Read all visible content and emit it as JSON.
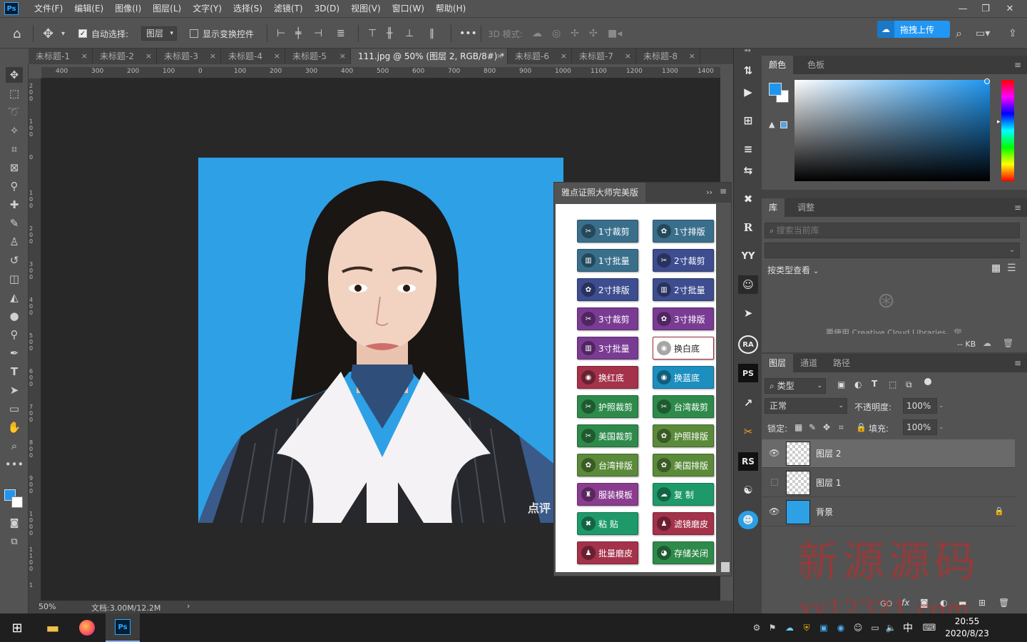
{
  "app": {
    "logo_text": "Ps"
  },
  "menu": [
    "文件(F)",
    "编辑(E)",
    "图像(I)",
    "图层(L)",
    "文字(Y)",
    "选择(S)",
    "滤镜(T)",
    "3D(D)",
    "视图(V)",
    "窗口(W)",
    "帮助(H)"
  ],
  "window_controls": {
    "minimize": "—",
    "restore": "❐",
    "close": "✕"
  },
  "options": {
    "auto_select_label": "自动选择:",
    "auto_select_value": "图层",
    "show_transform_label": "显示变换控件",
    "mode_3d_label": "3D 模式:",
    "more": "•••",
    "upload_label": "拖拽上传"
  },
  "doc_tabs": [
    {
      "label": "未标题-1",
      "close": "×"
    },
    {
      "label": "未标题-2",
      "close": "×"
    },
    {
      "label": "未标题-3",
      "close": "×"
    },
    {
      "label": "未标题-4",
      "close": "×"
    },
    {
      "label": "未标题-5",
      "close": "×"
    },
    {
      "label": "111.jpg @ 50% (图层 2, RGB/8#) *",
      "close": "×"
    },
    {
      "label": "未标题-6",
      "close": "×"
    },
    {
      "label": "未标题-7",
      "close": "×"
    },
    {
      "label": "未标题-8",
      "close": "×"
    }
  ],
  "ruler_h": [
    "400",
    "300",
    "200",
    "100",
    "0",
    "100",
    "200",
    "300",
    "400",
    "500",
    "600",
    "700",
    "800",
    "900",
    "1000",
    "1100",
    "1200",
    "1300",
    "1400"
  ],
  "ruler_v": [
    "2 0 0",
    "1 0 0",
    "0",
    "1 0 0",
    "2 0 0",
    "3 0 0",
    "4 0 0",
    "5 0 0",
    "6 0 0",
    "7 0 0",
    "8 0 0",
    "9 0 0",
    "1 0 0 0",
    "1 1 0 0",
    "1"
  ],
  "status": {
    "zoom": "50%",
    "doc": "文档:3.00M/12.2M",
    "arrow": "›"
  },
  "plugin": {
    "title": "雅点证照大师完美版",
    "collapse": "››",
    "buttons": [
      {
        "label": "1寸裁剪",
        "color": "#3a6f8c",
        "icon": "✂"
      },
      {
        "label": "1寸排版",
        "color": "#3a6f8c",
        "icon": "✿"
      },
      {
        "label": "1寸批量",
        "color": "#3a6f8c",
        "icon": "▥"
      },
      {
        "label": "2寸裁剪",
        "color": "#3d4d8f",
        "icon": "✂"
      },
      {
        "label": "2寸排版",
        "color": "#3d4d8f",
        "icon": "✿"
      },
      {
        "label": "2寸批量",
        "color": "#3d4d8f",
        "icon": "▥"
      },
      {
        "label": "3寸裁剪",
        "color": "#7a3b93",
        "icon": "✂"
      },
      {
        "label": "3寸排版",
        "color": "#7a3b93",
        "icon": "✿"
      },
      {
        "label": "3寸批量",
        "color": "#7a3b93",
        "icon": "▥"
      },
      {
        "label": "换白底",
        "color": "#ffffff",
        "icon": "◉",
        "text_color": "#222",
        "border": "#9a2a3c"
      },
      {
        "label": "换红底",
        "color": "#a3324a",
        "icon": "◉"
      },
      {
        "label": "换蓝底",
        "color": "#1d8fbf",
        "icon": "◉"
      },
      {
        "label": "护照裁剪",
        "color": "#2e8a4a",
        "icon": "✂"
      },
      {
        "label": "台湾裁剪",
        "color": "#2e8a4a",
        "icon": "✂"
      },
      {
        "label": "美国裁剪",
        "color": "#2e8a4a",
        "icon": "✂"
      },
      {
        "label": "护照排版",
        "color": "#5a8a3a",
        "icon": "✿"
      },
      {
        "label": "台湾排版",
        "color": "#5a8a3a",
        "icon": "✿"
      },
      {
        "label": "美国排版",
        "color": "#5a8a3a",
        "icon": "✿"
      },
      {
        "label": "服装模板",
        "color": "#8a3d8f",
        "icon": "♜"
      },
      {
        "label": "复 制",
        "color": "#1e9a6a",
        "icon": "☁"
      },
      {
        "label": "粘 贴",
        "color": "#1e9a6a",
        "icon": "✖"
      },
      {
        "label": "滤镜磨皮",
        "color": "#a3324a",
        "icon": "♟"
      },
      {
        "label": "批量磨皮",
        "color": "#a3324a",
        "icon": "♟"
      },
      {
        "label": "存储关闭",
        "color": "#2e8a4a",
        "icon": "◕"
      }
    ]
  },
  "mid_icons": [
    "⇅",
    "▶",
    "⊞",
    "≡",
    "⇆",
    "✖",
    "R",
    "YY",
    "☺",
    "➤",
    "RA",
    "PS",
    "↗",
    "✂",
    "RS",
    "☯",
    "☻"
  ],
  "color_panel": {
    "tabs": [
      "颜色",
      "色板"
    ],
    "fg_color": "#1e96f0",
    "bg_color": "#ffffff"
  },
  "library_panel": {
    "tabs": [
      "库",
      "调整"
    ],
    "search_placeholder": "搜索当前库",
    "view_label": "按类型查看",
    "cc_text": "要使用 Creative Cloud Libraries，您",
    "size": "-- KB"
  },
  "layers_panel": {
    "tabs": [
      "图层",
      "通道",
      "路径"
    ],
    "filter_label": "类型",
    "blend_mode": "正常",
    "opacity_label": "不透明度:",
    "opacity_value": "100%",
    "lock_label": "锁定:",
    "fill_label": "填充:",
    "fill_value": "100%",
    "layers": [
      {
        "name": "图层 2",
        "visible": true,
        "selected": true
      },
      {
        "name": "图层 1",
        "visible": false,
        "selected": false
      },
      {
        "name": "背景",
        "visible": true,
        "selected": false,
        "locked": true
      }
    ],
    "footer_icons": [
      "GO",
      "fx"
    ]
  },
  "canvas": {
    "photo_bg": "#2ea0e6",
    "overlay_text": "点评"
  },
  "taskbar": {
    "time": "20:55",
    "date": "2020/8/23",
    "ime": "中"
  },
  "watermark": {
    "line1": "新源源码",
    "line2": "xy12321.com"
  }
}
